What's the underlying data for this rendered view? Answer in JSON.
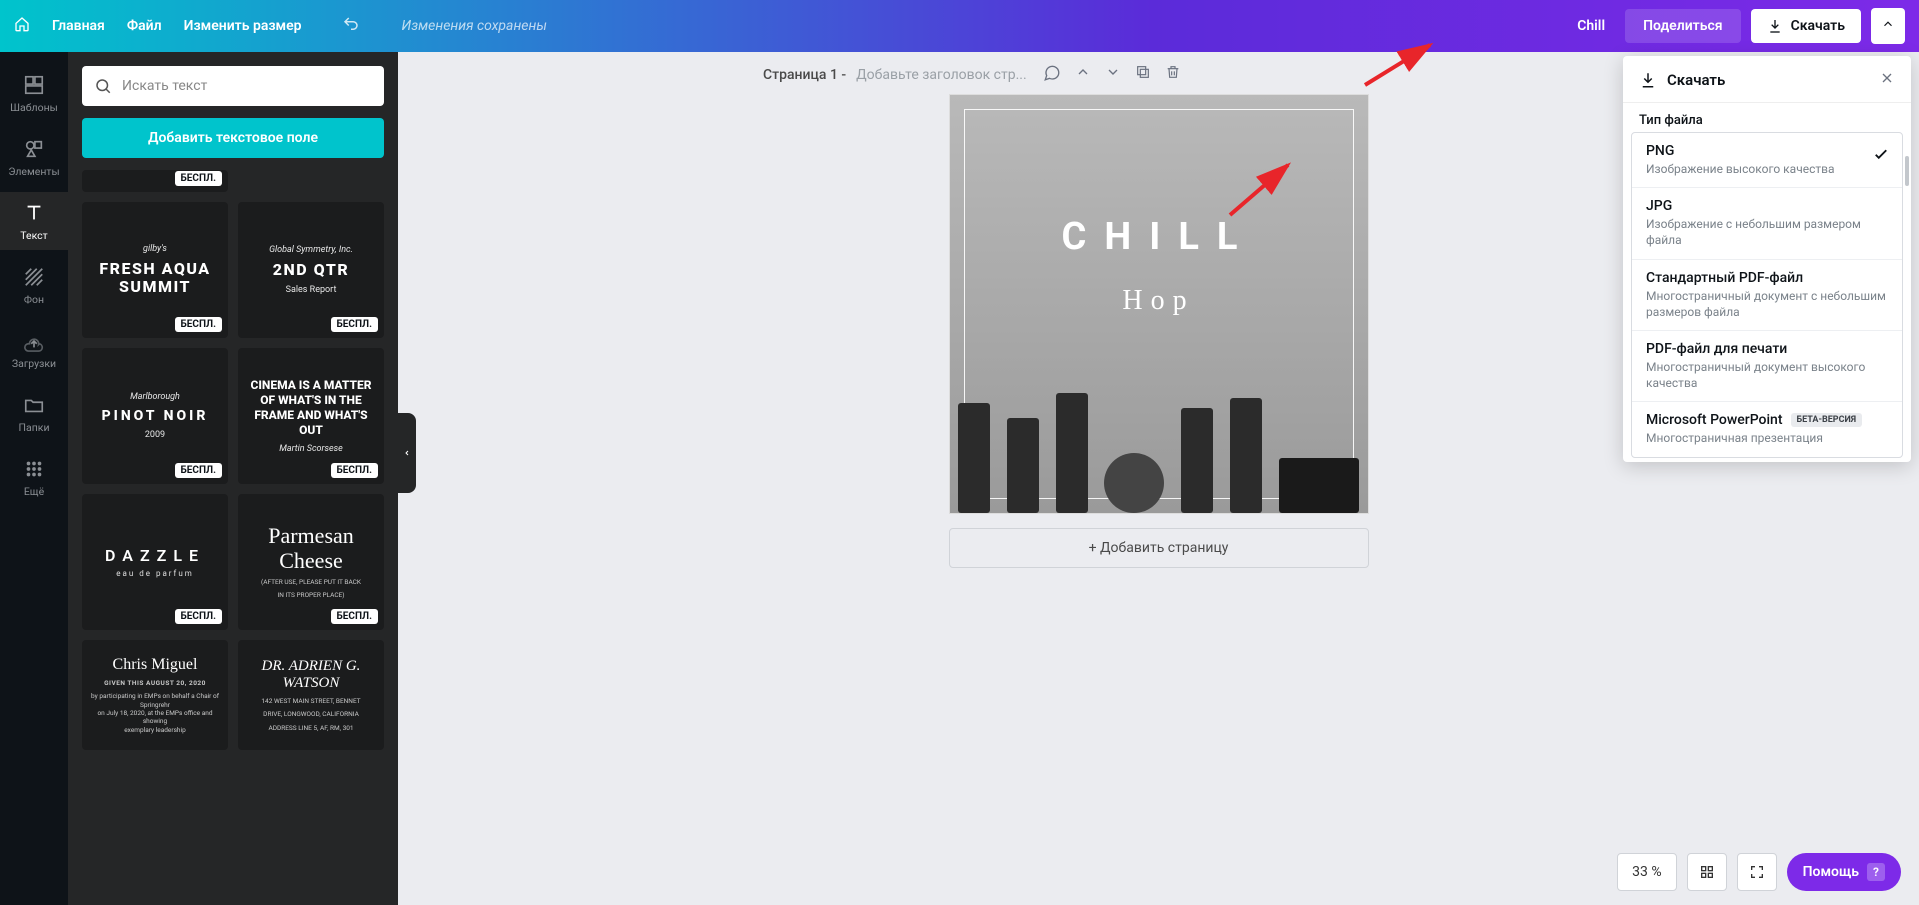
{
  "topbar": {
    "home": "Главная",
    "file": "Файл",
    "resize": "Изменить размер",
    "saved": "Изменения сохранены",
    "title": "Chill",
    "share": "Поделиться",
    "download": "Скачать"
  },
  "rail": {
    "templates": "Шаблоны",
    "elements": "Элементы",
    "text": "Текст",
    "background": "Фон",
    "uploads": "Загрузки",
    "folders": "Папки",
    "more": "Ещё"
  },
  "panel": {
    "search_placeholder": "Искать текст",
    "add_text": "Добавить текстовое поле",
    "badge": "БЕСПЛ.",
    "cards": {
      "c1": {
        "l1": "gilby's",
        "l2a": "FRESH AQUA",
        "l2b": "SUMMIT"
      },
      "c2": {
        "l1": "Global Symmetry, Inc.",
        "l2": "2ND QTR",
        "l3": "Sales Report"
      },
      "c3": {
        "l1": "Marlborough",
        "l2": "PINOT NOIR",
        "l3": "2009"
      },
      "c4": {
        "t": "CINEMA IS A MATTER OF WHAT'S IN THE FRAME AND WHAT'S OUT",
        "l3": "Martin Scorsese"
      },
      "c5": {
        "l2": "DAZZLE",
        "l3": "eau de parfum"
      },
      "c6": {
        "l2a": "Parmesan",
        "l2b": "Cheese",
        "l3a": "(AFTER USE, PLEASE PUT IT BACK",
        "l3b": "IN ITS PROPER PLACE)"
      },
      "c7": {
        "l2": "Chris Miguel",
        "l3": "GIVEN THIS AUGUST 20, 2020"
      },
      "c8": {
        "l2a": "DR. ADRIEN G.",
        "l2b": "WATSON",
        "l3a": "142 WEST MAIN STREET, BENNET",
        "l3b": "DRIVE, LONGWOOD, CALIFORNIA",
        "l3c": "ADDRESS LINE 5, AF, RM, 301"
      }
    }
  },
  "page": {
    "label_prefix": "Страница 1 - ",
    "placeholder": "Добавьте заголовок стр...",
    "canvas_title": "CHILL",
    "canvas_sub": "Hop",
    "add_page": "+ Добавить страницу"
  },
  "zoom": {
    "value": "33 %",
    "help": "Помощь"
  },
  "download_panel": {
    "title": "Скачать",
    "section": "Тип файла",
    "opts": [
      {
        "name": "PNG",
        "desc": "Изображение высокого качества",
        "selected": true
      },
      {
        "name": "JPG",
        "desc": "Изображение с небольшим размером файла"
      },
      {
        "name": "Стандартный PDF-файл",
        "desc": "Многостраничный документ с небольшим размеров файла"
      },
      {
        "name": "PDF-файл для печати",
        "desc": "Многостраничный документ высокого качества"
      },
      {
        "name": "Microsoft PowerPoint",
        "desc": "Многостраничная презентация",
        "beta": "БЕТА-ВЕРСИЯ"
      }
    ]
  }
}
